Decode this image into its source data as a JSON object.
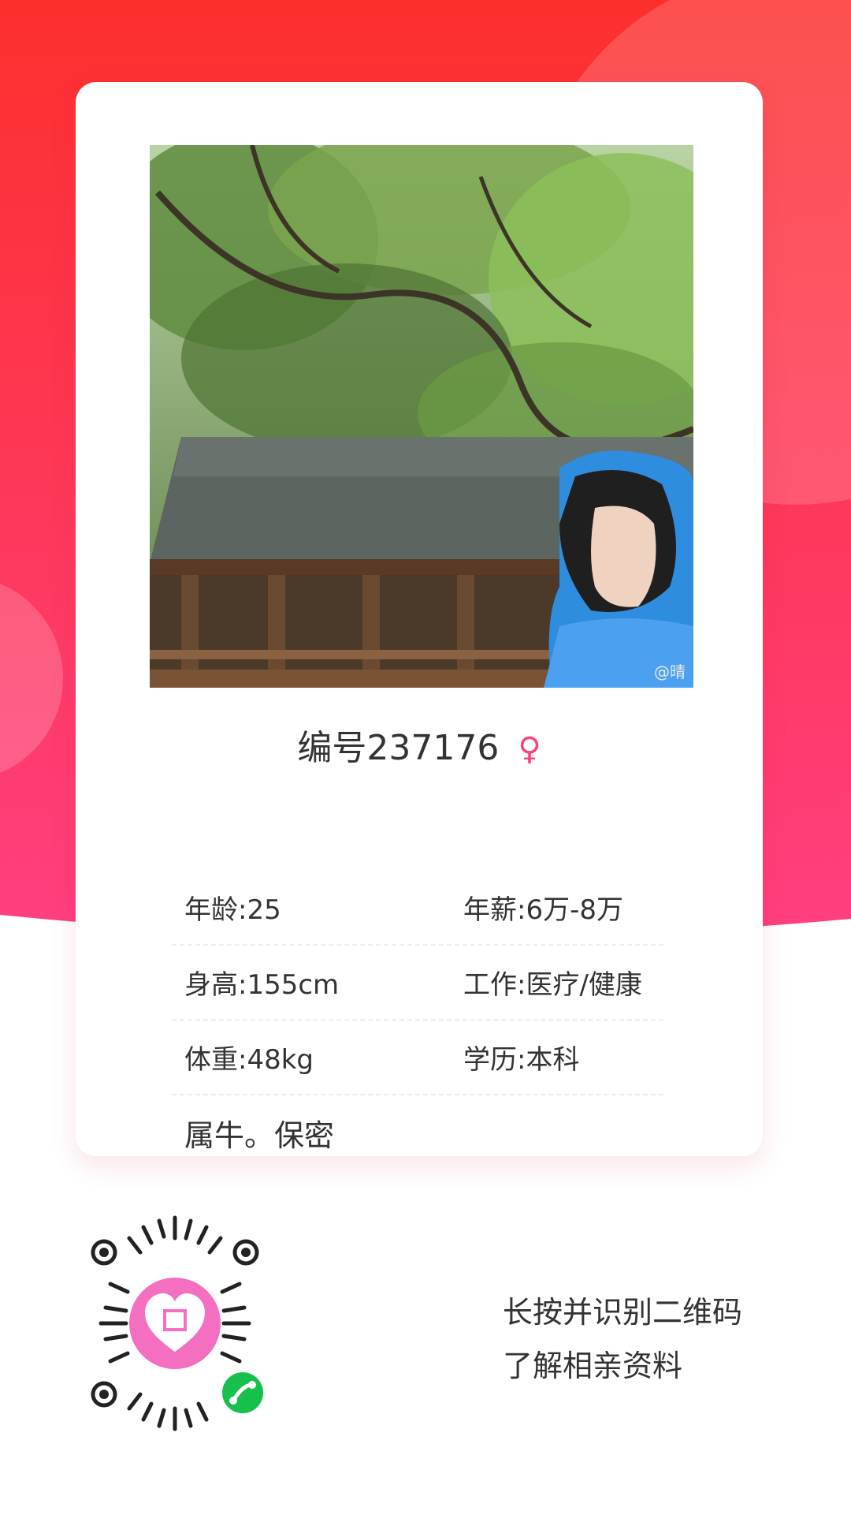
{
  "profile": {
    "title": "编号237176",
    "gender_symbol": "♀",
    "fields": [
      {
        "left": "年龄:25",
        "right": "年薪:6万-8万"
      },
      {
        "left": "身高:155cm",
        "right": "工作:医疗/健康"
      },
      {
        "left": "体重:48kg",
        "right": "学历:本科"
      }
    ],
    "intro": "属牛。保密"
  },
  "qr": {
    "line1": "长按并识别二维码",
    "line2": "了解相亲资料",
    "icon": "heart-logo-icon",
    "badge_icon": "mini-program-icon"
  },
  "photo": {
    "watermark": "@晴"
  },
  "colors": {
    "primary": "#ff3f5b",
    "gradient_top": "#fd2f2d",
    "gradient_bottom": "#ff3e7e",
    "text": "#333333",
    "gender": "#ff3d7f"
  }
}
